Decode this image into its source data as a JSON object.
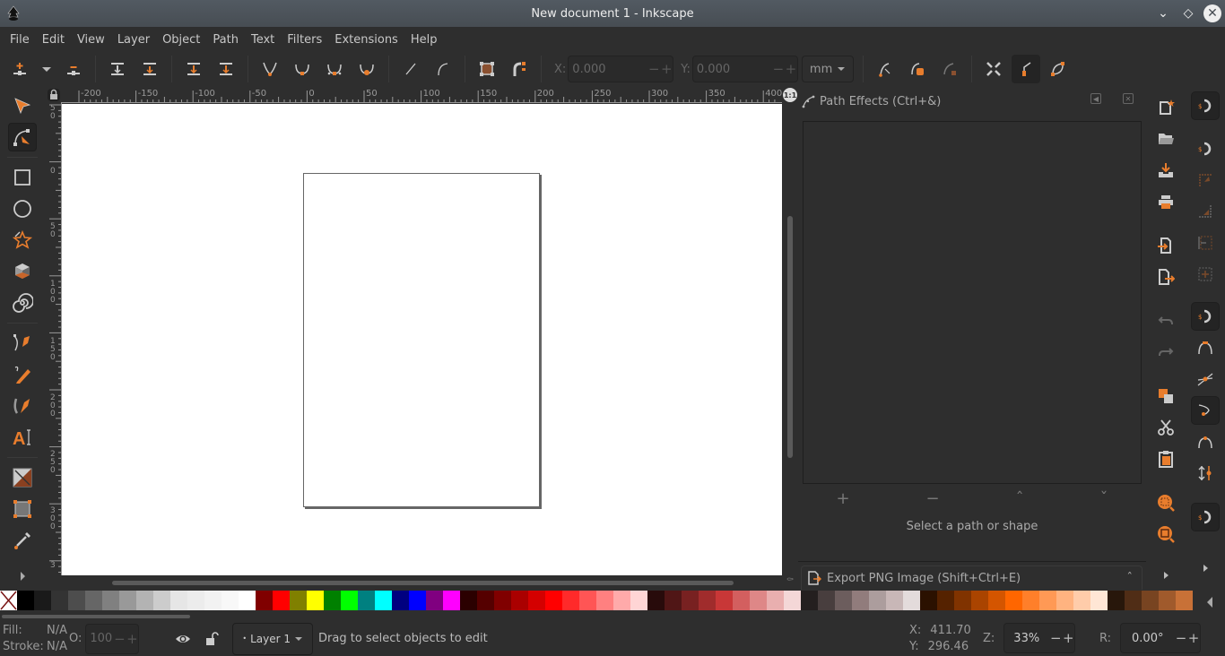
{
  "window": {
    "title": "New document 1 - Inkscape"
  },
  "menu": [
    "File",
    "Edit",
    "View",
    "Layer",
    "Object",
    "Path",
    "Text",
    "Filters",
    "Extensions",
    "Help"
  ],
  "toolbar": {
    "x_label": "X:",
    "x_value": "0.000",
    "y_label": "Y:",
    "y_value": "0.000",
    "unit": "mm"
  },
  "ruler": {
    "h_ticks": [
      "-200",
      "-150",
      "-100",
      "-50",
      "0",
      "50",
      "100",
      "150",
      "200",
      "250",
      "300",
      "350",
      "400"
    ],
    "v_ticks": [
      "5\n0",
      "0",
      "5\n0",
      "1\n0\n0",
      "1\n5\n0",
      "2\n0\n0",
      "2\n5\n0",
      "3\n0\n0",
      "3"
    ]
  },
  "dock": {
    "path_effects_title": "Path Effects (Ctrl+&)",
    "message": "Select a path or shape",
    "export_title": "Export PNG Image (Shift+Ctrl+E)"
  },
  "palette": [
    "#000000",
    "#1a1a1a",
    "#333333",
    "#4d4d4d",
    "#666666",
    "#808080",
    "#999999",
    "#b3b3b3",
    "#cccccc",
    "#e6e6e6",
    "#ececec",
    "#f2f2f2",
    "#f8f8f8",
    "#ffffff",
    "#800000",
    "#ff0000",
    "#808000",
    "#ffff00",
    "#008000",
    "#00ff00",
    "#008080",
    "#00ffff",
    "#000080",
    "#0000ff",
    "#800080",
    "#ff00ff",
    "#2b0000",
    "#550000",
    "#800000",
    "#aa0000",
    "#d40000",
    "#ff0000",
    "#ff2a2a",
    "#ff5555",
    "#ff8080",
    "#ffaaaa",
    "#ffd5d5",
    "#280b0b",
    "#501616",
    "#782121",
    "#a02c2c",
    "#c83737",
    "#d35f5f",
    "#de8787",
    "#e9afaf",
    "#f4d7d7",
    "#241f1f",
    "#483e3e",
    "#6c5d5d",
    "#917c7c",
    "#ac9d9d",
    "#c8b7b7",
    "#e3dbdb",
    "#2b1100",
    "#552200",
    "#803300",
    "#aa4400",
    "#d45500",
    "#ff6600",
    "#ff7f2a",
    "#ff9955",
    "#ffb380",
    "#ffccaa",
    "#ffe6d5",
    "#28170b",
    "#502d16",
    "#784421",
    "#a05a2c",
    "#c87137"
  ],
  "status": {
    "fill_label": "Fill:",
    "fill_value": "N/A",
    "stroke_label": "Stroke:",
    "stroke_value": "N/A",
    "opacity_label": "O:",
    "opacity_value": "100",
    "layer": "Layer 1",
    "message": "Drag to select objects to edit",
    "x_label": "X:",
    "x_value": "411.70",
    "y_label": "Y:",
    "y_value": "296.46",
    "zoom_label": "Z:",
    "zoom_value": "33%",
    "rotation_label": "R:",
    "rotation_value": "0.00°"
  }
}
